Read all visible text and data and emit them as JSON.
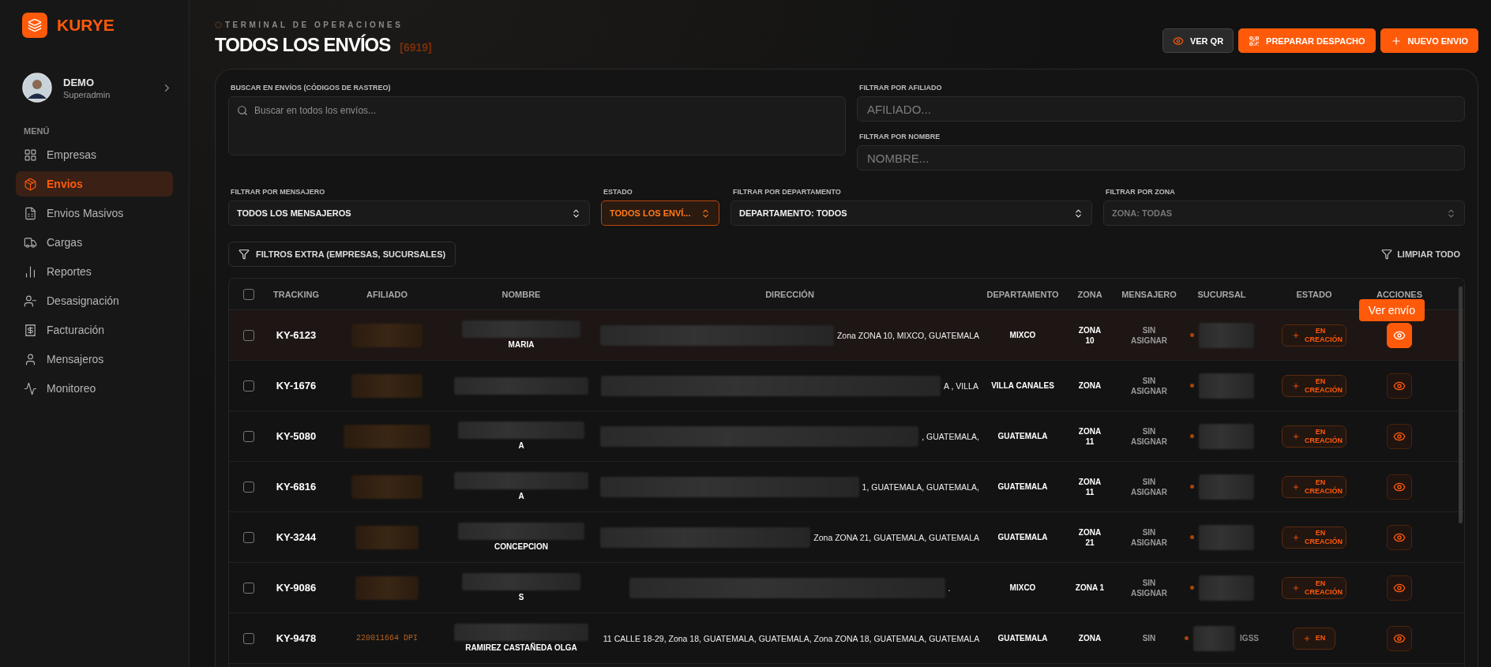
{
  "brand": {
    "name": "KURYE"
  },
  "user": {
    "name": "DEMO",
    "role": "Superadmin"
  },
  "menu": {
    "heading": "MENÚ",
    "items": [
      {
        "label": "Empresas",
        "selected": false
      },
      {
        "label": "Envios",
        "selected": true
      },
      {
        "label": "Envios Masivos",
        "selected": false
      },
      {
        "label": "Cargas",
        "selected": false
      },
      {
        "label": "Reportes",
        "selected": false
      },
      {
        "label": "Desasignación",
        "selected": false
      },
      {
        "label": "Facturación",
        "selected": false
      },
      {
        "label": "Mensajeros",
        "selected": false
      },
      {
        "label": "Monitoreo",
        "selected": false
      }
    ]
  },
  "header": {
    "eyebrow": "TERMINAL DE OPERACIONES",
    "title": "TODOS LOS ENVÍOS",
    "count": "[6919]",
    "actions": [
      {
        "label": "VER QR",
        "kind": "outline"
      },
      {
        "label": "PREPARAR DESPACHO",
        "kind": "primary"
      },
      {
        "label": "NUEVO ENVIO",
        "kind": "primary"
      }
    ]
  },
  "search": {
    "label": "BUSCAR EN ENVÍOS (CÓDIGOS DE RASTREO)",
    "placeholder": "Buscar en todos los envíos..."
  },
  "side_filters": [
    {
      "label": "FILTRAR POR AFILIADO",
      "placeholder": "AFILIADO..."
    },
    {
      "label": "FILTRAR POR NOMBRE",
      "placeholder": "NOMBRE..."
    }
  ],
  "selects": [
    {
      "label": "FILTRAR POR MENSAJERO",
      "value": "TODOS LOS MENSAJEROS",
      "active": false,
      "disabled": false
    },
    {
      "label": "ESTADO",
      "value": "TODOS LOS ENVÍ...",
      "active": true,
      "disabled": false
    },
    {
      "label": "FILTRAR POR DEPARTAMENTO",
      "value": "DEPARTAMENTO: TODOS",
      "active": false,
      "disabled": false
    },
    {
      "label": "FILTRAR POR ZONA",
      "value": "ZONA: TODAS",
      "active": false,
      "disabled": true
    }
  ],
  "extra_filters": "FILTROS EXTRA (EMPRESAS, SUCURSALES)",
  "clear": "LIMPIAR TODO",
  "table": {
    "select_all": {
      "checked": false
    },
    "columns": [
      "TRACKING",
      "AFILIADO",
      "NOMBRE",
      "DIRECCIÓN",
      "DEPARTAMENTO",
      "ZONA",
      "MENSAJERO",
      "SUCURSAL",
      "ESTADO",
      "ACCIONES"
    ],
    "tooltip": "Ver envío",
    "rows": [
      {
        "checked": false,
        "highlighted": true,
        "tracking": "KY-6123",
        "nombre": "MARIA",
        "direccion": "Zona ZONA 10, MIXCO, GUATEMALA",
        "departamento": "MIXCO",
        "zona": "ZONA 10",
        "mensajero": "SIN ASIGNAR",
        "estado": "EN CREACIÓN"
      },
      {
        "checked": false,
        "highlighted": false,
        "tracking": "KY-1676",
        "direccion": "A , VILLA",
        "departamento": "VILLA CANALES",
        "zona": "ZONA",
        "mensajero": "SIN ASIGNAR",
        "estado": "EN CREACIÓN"
      },
      {
        "checked": false,
        "highlighted": false,
        "tracking": "KY-5080",
        "nombre": "A",
        "direccion": ", GUATEMALA,",
        "departamento": "GUATEMALA",
        "zona": "ZONA 11",
        "mensajero": "SIN ASIGNAR",
        "estado": "EN CREACIÓN"
      },
      {
        "checked": false,
        "highlighted": false,
        "tracking": "KY-6816",
        "nombre": "A",
        "direccion": "1, GUATEMALA, GUATEMALA,",
        "departamento": "GUATEMALA",
        "zona": "ZONA 11",
        "mensajero": "SIN ASIGNAR",
        "estado": "EN CREACIÓN"
      },
      {
        "checked": false,
        "highlighted": false,
        "tracking": "KY-3244",
        "nombre": "CONCEPCION",
        "direccion": "Zona ZONA 21, GUATEMALA, GUATEMALA",
        "departamento": "GUATEMALA",
        "zona": "ZONA 21",
        "mensajero": "SIN ASIGNAR",
        "estado": "EN CREACIÓN"
      },
      {
        "checked": false,
        "highlighted": false,
        "tracking": "KY-9086",
        "nombre": "S",
        "direccion": ".",
        "departamento": "MIXCO",
        "zona": "ZONA 1",
        "mensajero": "SIN ASIGNAR",
        "estado": "EN CREACIÓN"
      },
      {
        "checked": false,
        "highlighted": false,
        "tracking": "KY-9478",
        "afiliado": "220011664 DPI",
        "nombre": "RAMIREZ CASTAÑEDA OLGA",
        "direccion": "11 CALLE 18-29, Zona 18, GUATEMALA, GUATEMALA, Zona ZONA 18, GUATEMALA, GUATEMALA",
        "departamento": "GUATEMALA",
        "zona": "ZONA",
        "mensajero": "SIN",
        "sucursal": "IGSS",
        "estado": "EN"
      }
    ]
  }
}
